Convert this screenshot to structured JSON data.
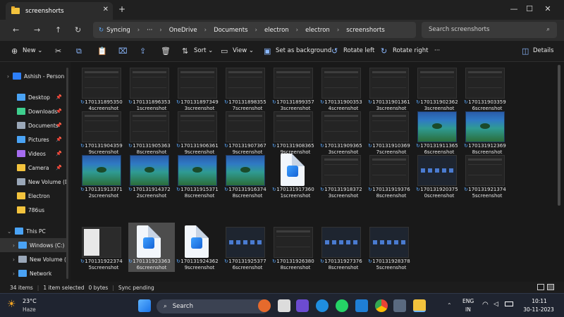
{
  "window": {
    "tab_title": "screenshorts",
    "new_tab": "+",
    "minimize": "—",
    "maximize": "☐",
    "close": "✕"
  },
  "address": {
    "sync_label": "Syncing",
    "ellipsis": "···",
    "crumbs": [
      "OneDrive",
      "Documents",
      "electron",
      "electron",
      "screenshorts"
    ],
    "search_placeholder": "Search screenshorts"
  },
  "toolbar": {
    "new": "New",
    "sort": "Sort",
    "view": "View",
    "set_background": "Set as background",
    "rotate_left": "Rotate left",
    "rotate_right": "Rotate right",
    "more": "···",
    "details": "Details"
  },
  "sidebar": {
    "items": [
      {
        "label": "Ashish - Person",
        "icon": "cloud-icon",
        "color": "#2d7ff9"
      },
      {
        "label": "Desktop",
        "icon": "desktop-icon",
        "color": "#4aa3f5",
        "pinned": true
      },
      {
        "label": "Downloads",
        "icon": "download-icon",
        "color": "#3ecf8e",
        "pinned": true
      },
      {
        "label": "Documents",
        "icon": "document-icon",
        "color": "#9aa7b8",
        "pinned": true
      },
      {
        "label": "Pictures",
        "icon": "pictures-icon",
        "color": "#4aa3f5",
        "pinned": true
      },
      {
        "label": "Videos",
        "icon": "videos-icon",
        "color": "#a66cf0",
        "pinned": true
      },
      {
        "label": "Camera",
        "icon": "folder-icon",
        "color": "#f3c33d",
        "pinned": true
      },
      {
        "label": "New Volume (D:",
        "icon": "drive-icon",
        "color": "#9aa7b8"
      },
      {
        "label": "Electron",
        "icon": "folder-icon",
        "color": "#f3c33d"
      },
      {
        "label": "786us",
        "icon": "folder-icon",
        "color": "#f3c33d"
      },
      {
        "label": "This PC",
        "icon": "pc-icon",
        "color": "#4aa3f5"
      },
      {
        "label": "Windows (C:)",
        "icon": "drive-icon",
        "color": "#4aa3f5"
      },
      {
        "label": "New Volume (E",
        "icon": "drive-icon",
        "color": "#9aa7b8"
      },
      {
        "label": "Network",
        "icon": "network-icon",
        "color": "#4aa3f5"
      }
    ]
  },
  "files": [
    {
      "name": "1701318953504screenshot",
      "kind": "dark"
    },
    {
      "name": "1701318963531screenshot",
      "kind": "dark"
    },
    {
      "name": "1701318973493screenshot",
      "kind": "dark"
    },
    {
      "name": "1701318983557screenshot",
      "kind": "dark"
    },
    {
      "name": "1701318993573screenshot",
      "kind": "dark"
    },
    {
      "name": "1701319003534screenshot",
      "kind": "dark"
    },
    {
      "name": "1701319013613screenshot",
      "kind": "dark"
    },
    {
      "name": "1701319023623screenshot",
      "kind": "dark"
    },
    {
      "name": "1701319033596screenshot",
      "kind": "dark"
    },
    {
      "name": "1701319043599screenshot",
      "kind": "dark"
    },
    {
      "name": "1701319053638screenshot",
      "kind": "dark"
    },
    {
      "name": "1701319063619screenshot",
      "kind": "dark"
    },
    {
      "name": "1701319073679screenshot",
      "kind": "dark"
    },
    {
      "name": "1701319083659screenshot",
      "kind": "dark"
    },
    {
      "name": "1701319093653screenshot",
      "kind": "dark"
    },
    {
      "name": "1701319103697screenshot",
      "kind": "dark"
    },
    {
      "name": "1701319113656screenshot",
      "kind": "ocean"
    },
    {
      "name": "1701319123698screenshot",
      "kind": "ocean"
    },
    {
      "name": "1701319133712screenshot",
      "kind": "ocean"
    },
    {
      "name": "1701319143722screenshot",
      "kind": "ocean"
    },
    {
      "name": "1701319153718screenshot",
      "kind": "ocean"
    },
    {
      "name": "1701319163748screenshot",
      "kind": "ocean"
    },
    {
      "name": "1701319173601screenshot",
      "kind": "file"
    },
    {
      "name": "1701319183723screenshot",
      "kind": "dark"
    },
    {
      "name": "1701319193768screenshot",
      "kind": "dark"
    },
    {
      "name": "1701319203750screenshot",
      "kind": "bluebar"
    },
    {
      "name": "1701319213745screenshot",
      "kind": "dark"
    },
    {
      "name": "1701319223745screenshot",
      "kind": "mixed"
    },
    {
      "name": "1701319233636screenshot",
      "kind": "file",
      "selected": true
    },
    {
      "name": "1701319243629screenshot",
      "kind": "file"
    },
    {
      "name": "1701319253776screenshot",
      "kind": "bluebar"
    },
    {
      "name": "1701319263808screenshot",
      "kind": "dark"
    },
    {
      "name": "1701319273768screenshot",
      "kind": "bluebar"
    },
    {
      "name": "1701319283785screenshot",
      "kind": "bluebar"
    }
  ],
  "status": {
    "count": "34 items",
    "selected": "1 item selected",
    "size": "0 bytes",
    "sync": "Sync pending"
  },
  "taskbar": {
    "temp": "23°C",
    "weather": "Haze",
    "search": "Search",
    "lang": "ENG",
    "region": "IN",
    "time": "10:11",
    "date": "30-11-2023"
  }
}
